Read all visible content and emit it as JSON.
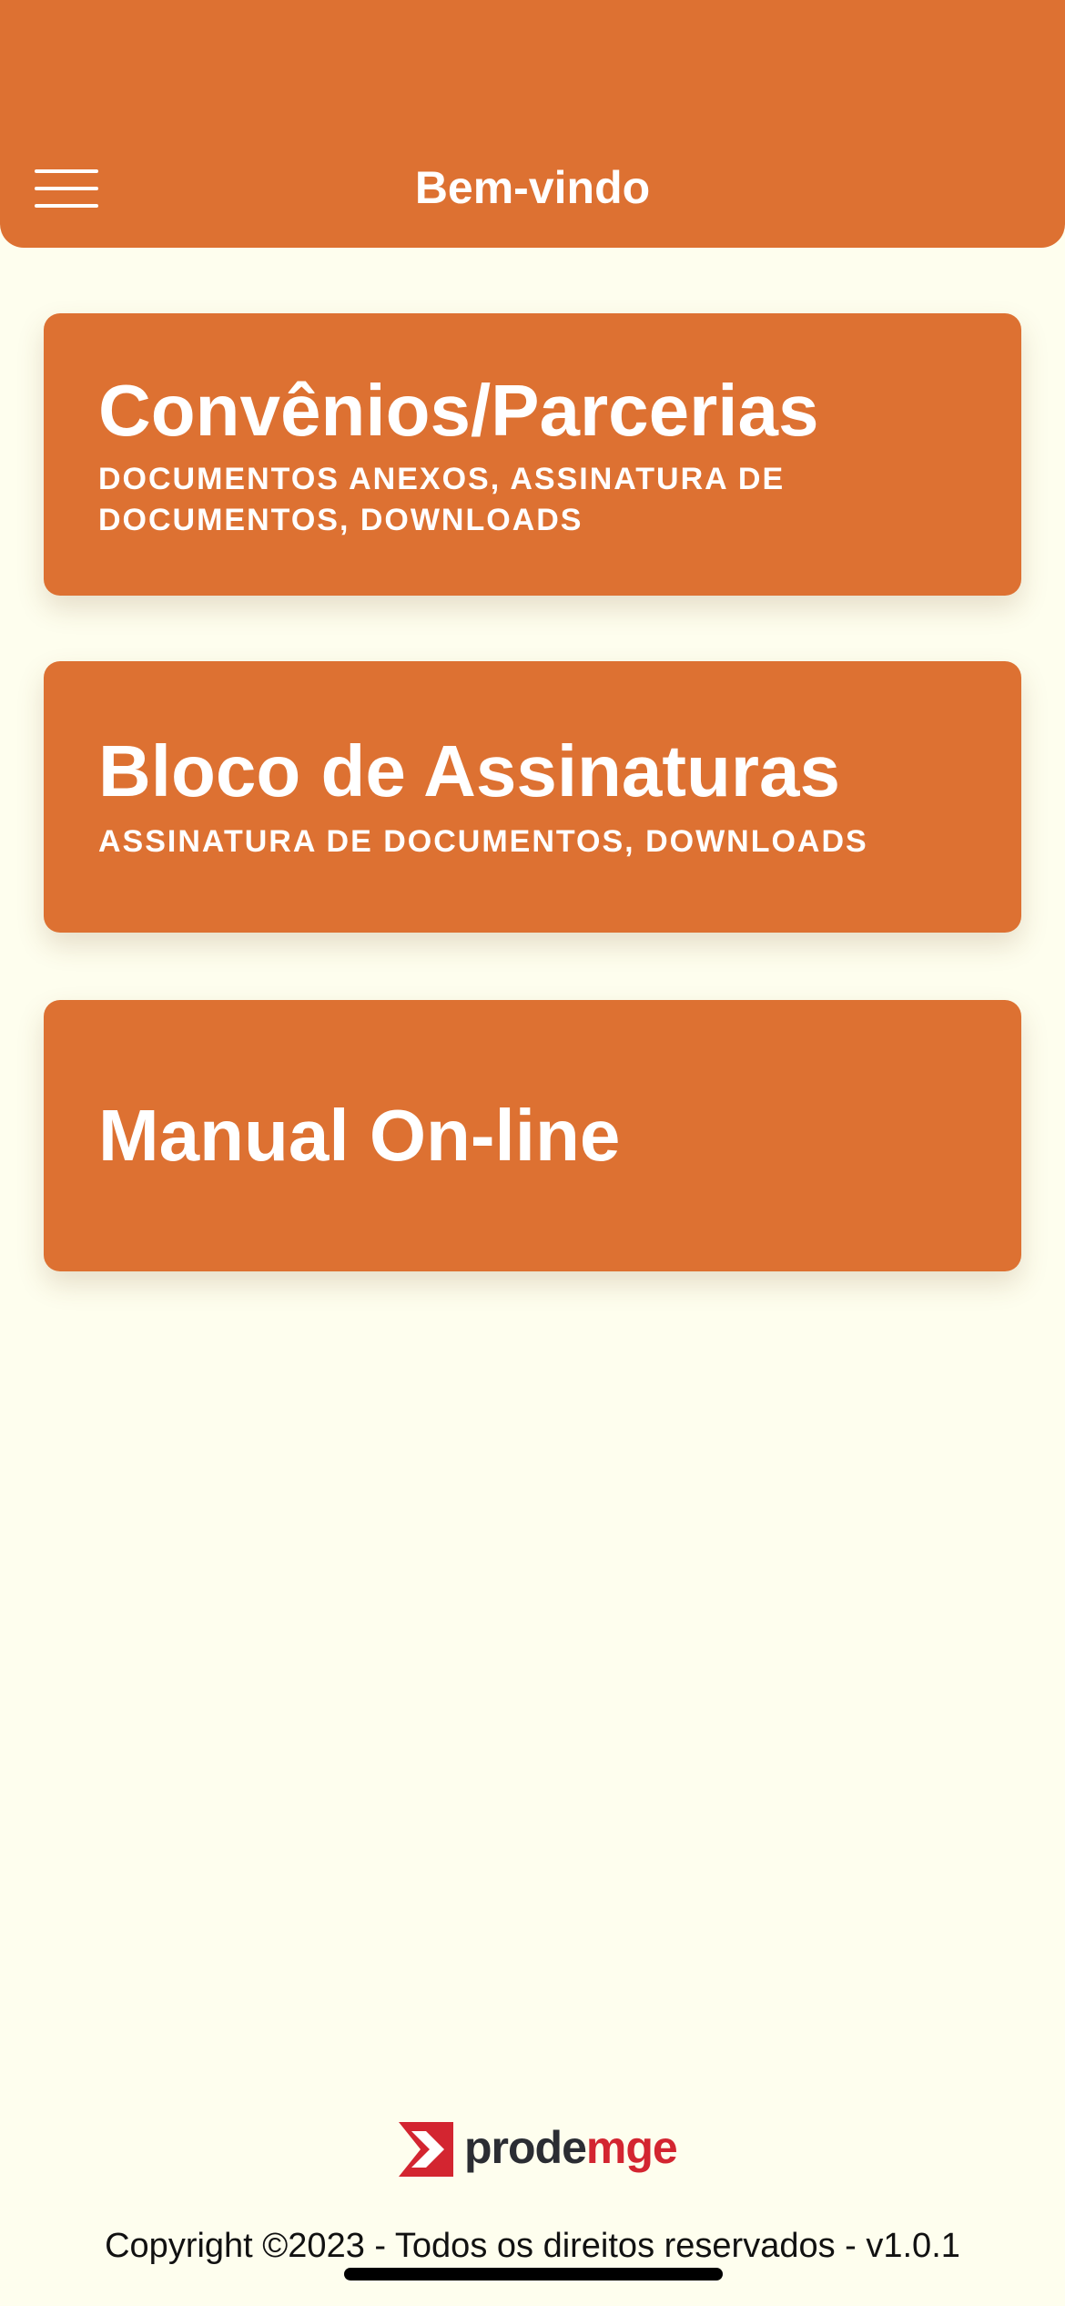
{
  "header": {
    "title": "Bem-vindo",
    "menu_icon": "hamburger-menu-icon"
  },
  "cards": [
    {
      "title": "Convênios/Parcerias",
      "subtitle": "DOCUMENTOS ANEXOS, ASSINATURA DE DOCUMENTOS, DOWNLOADS"
    },
    {
      "title": "Bloco de Assinaturas",
      "subtitle": "ASSINATURA DE DOCUMENTOS, DOWNLOADS"
    },
    {
      "title": "Manual On-line",
      "subtitle": ""
    }
  ],
  "footer": {
    "logo_text_dark": "prode",
    "logo_text_accent": "mge",
    "copyright": "Copyright ©2023 - Todos os direitos reservados - v1.0.1"
  },
  "colors": {
    "accent": "#DD7132",
    "background": "#FEFEEE",
    "logo_red": "#D32530",
    "logo_dark": "#2B2D33"
  }
}
